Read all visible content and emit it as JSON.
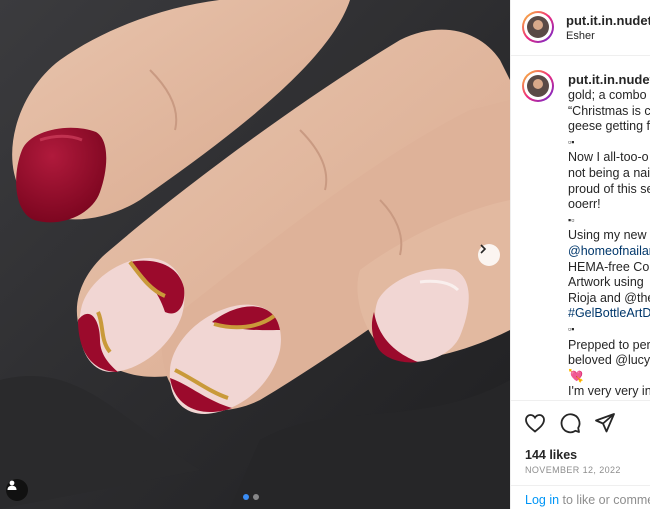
{
  "post": {
    "username": "put.it.in.nudetr",
    "location": "Esher",
    "caption_lines": [
      "gold; a combo",
      "“Christmas is c",
      "geese getting f",
      "▫▪",
      "Now I all-too-o",
      "not being a nai",
      "proud of this se",
      "ooerr!",
      "▪▫",
      "Using my new",
      "@homeofnailar",
      "HEMA-free Cor",
      "Artwork using",
      "Rioja and @the",
      "#GelBottleArtD",
      "▫▪",
      "Prepped to per",
      "beloved @lucyp",
      "💘",
      "I'm very very in"
    ],
    "likes": "144 likes",
    "date": "NOVEMBER 12, 2022",
    "login_link": "Log in",
    "login_rest": " to like or comme"
  },
  "carousel": {
    "count": 2,
    "active": 0
  },
  "icons": {
    "like": "heart-icon",
    "comment": "comment-icon",
    "share": "share-icon",
    "next": "chevron-right-icon",
    "tag": "user-tag-icon"
  },
  "colors": {
    "accent_link": "#00376b",
    "login_blue": "#0095f6",
    "nail_red": "#9b0a2c",
    "gold": "#c99a3a"
  }
}
